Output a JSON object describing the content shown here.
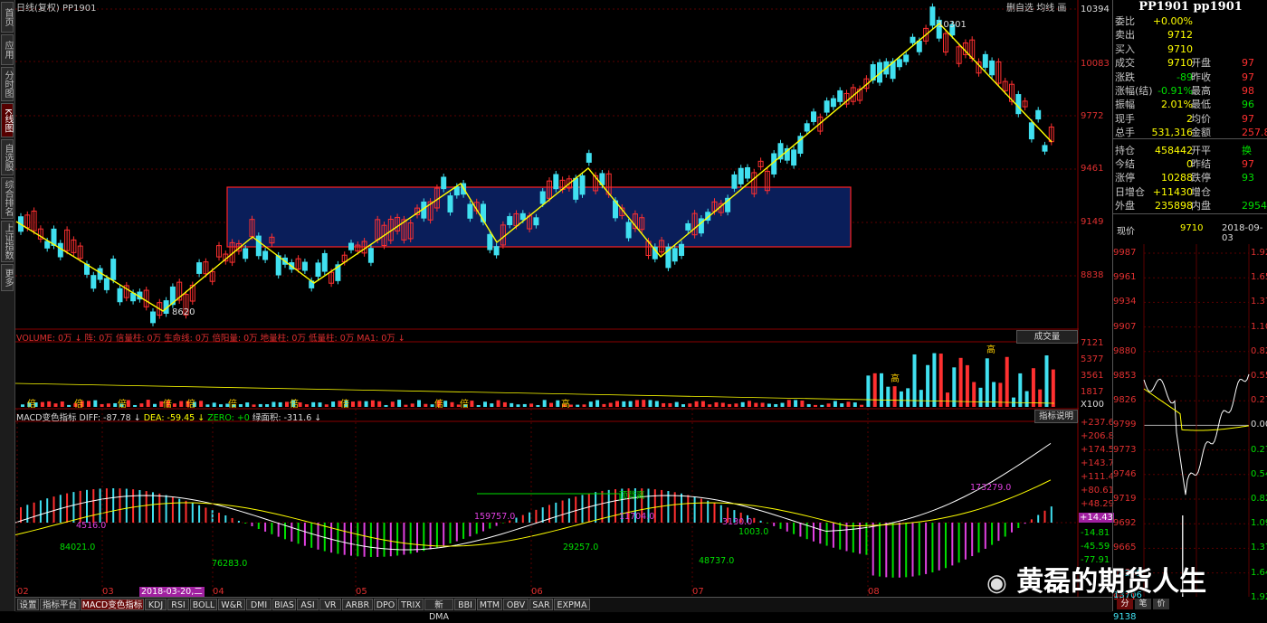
{
  "header": {
    "chart_title": "日线(复权) PP1901",
    "right_links": [
      "删自选",
      "均线",
      "画"
    ]
  },
  "left_tabs": [
    "首页",
    "应用",
    "分时图",
    "K线图",
    "自选股",
    "综合排名",
    "上证指数",
    "更多"
  ],
  "price_axis": [
    "10394",
    "10083",
    "9772",
    "9461",
    "9149",
    "8838"
  ],
  "price_annotations": {
    "high": "10301",
    "low": "8620"
  },
  "x_dates": [
    "02",
    "03",
    "04",
    "05",
    "06",
    "07",
    "08"
  ],
  "volume_panel": {
    "label": "VOLUME: 0万 ↓  阵: 0万  信量柱: 0万  生命线: 0万  倍阳量: 0万  地量柱: 0万  低量柱: 0万  MA1: 0万 ↓",
    "button": "成交量",
    "axis": [
      "7121",
      "5377",
      "3561",
      "1817",
      "X100"
    ],
    "bar_marks": [
      "倍",
      "倍",
      "倍",
      "倍",
      "倍",
      "倍",
      "倍",
      "倍",
      "倍",
      "倍",
      "高",
      "高",
      "高"
    ]
  },
  "macd_panel": {
    "title": "MACD变色指标",
    "diff": "DIFF: -87.78 ↓",
    "dea": "DEA: -59.45 ↓",
    "zero": "ZERO: +0",
    "hist": "绿面积: -311.6 ↓",
    "button": "指标说明",
    "axis": [
      "+237.6",
      "+206.8",
      "+174.5",
      "+143.7",
      "+111.4",
      "+80.61",
      "+48.29",
      "+14.43",
      "-14.81",
      "-45.59",
      "-77.91"
    ],
    "annotations": [
      "84021.0",
      "4516.0",
      "76283.0",
      "159757.0",
      "29257.0",
      "11704.0",
      "顶背离",
      "48737.0",
      "1003.0",
      "3130.0",
      "173279.0"
    ]
  },
  "date_highlight": "2018-03-20,二",
  "bottom_tabs": [
    "设置",
    "指标平台",
    "MACD变色指标",
    "KDJ",
    "RSI",
    "BOLL",
    "W&R",
    "DMI",
    "BIAS",
    "ASI",
    "VR",
    "ARBR",
    "DPO",
    "TRIX",
    "新DMA",
    "BBI",
    "MTM",
    "OBV",
    "SAR",
    "EXPMA"
  ],
  "quote": {
    "code_title": "PP1901 pp1901",
    "rows": [
      {
        "l1": "委比",
        "v1": "+0.00%"
      },
      {
        "l1": "卖出",
        "v1": "9712"
      },
      {
        "l1": "买入",
        "v1": "9710"
      },
      {
        "l1": "成交",
        "v1": "9710",
        "l2": "开盘",
        "v2": "97"
      },
      {
        "l1": "涨跌",
        "v1": "-89",
        "l2": "昨收",
        "v2": "97"
      },
      {
        "l1": "涨幅(结)",
        "v1": "-0.91%",
        "l2": "最高",
        "v2": "98"
      },
      {
        "l1": "振幅",
        "v1": "2.01%",
        "l2": "最低",
        "v2": "96"
      },
      {
        "l1": "现手",
        "v1": "2",
        "l2": "均价",
        "v2": "97"
      },
      {
        "l1": "总手",
        "v1": "531,316",
        "l2": "金额",
        "v2": "257.8"
      },
      {
        "l1": "持仓",
        "v1": "458442",
        "l2": "开平",
        "v2": "换"
      },
      {
        "l1": "今结",
        "v1": "0",
        "l2": "昨结",
        "v2": "97"
      },
      {
        "l1": "涨停",
        "v1": "10288",
        "l2": "跌停",
        "v2": "93"
      },
      {
        "l1": "日增仓",
        "v1": "+11430",
        "l2": "增仓",
        "v2": ""
      },
      {
        "l1": "外盘",
        "v1": "235898",
        "l2": "内盘",
        "v2": "2954"
      }
    ]
  },
  "mini_chart": {
    "label": "现价",
    "price": "9710",
    "date": "2018-09-03",
    "left_axis": [
      "9987",
      "9961",
      "9934",
      "9907",
      "9880",
      "9853",
      "9826",
      "9799",
      "9773",
      "9746",
      "9719",
      "9692",
      "9665",
      "9638",
      "9611",
      "18275",
      "13706",
      "9138"
    ],
    "right_axis": [
      "1.92",
      "1.65",
      "1.37",
      "1.10",
      "0.82",
      "0.55",
      "0.27",
      "0.00",
      "0.27",
      "0.54",
      "0.82",
      "1.09",
      "1.37",
      "1.64",
      "1.92"
    ],
    "tabs": [
      "分",
      "笔",
      "价"
    ]
  },
  "watermark": "黄磊的期货人生",
  "colors": {
    "up": "#ff3030",
    "down": "#40e0f0",
    "trend": "#ffff00",
    "box": "#0a1e5a",
    "box_border": "#ff2020",
    "green": "#00e000",
    "magenta": "#e040e0"
  }
}
